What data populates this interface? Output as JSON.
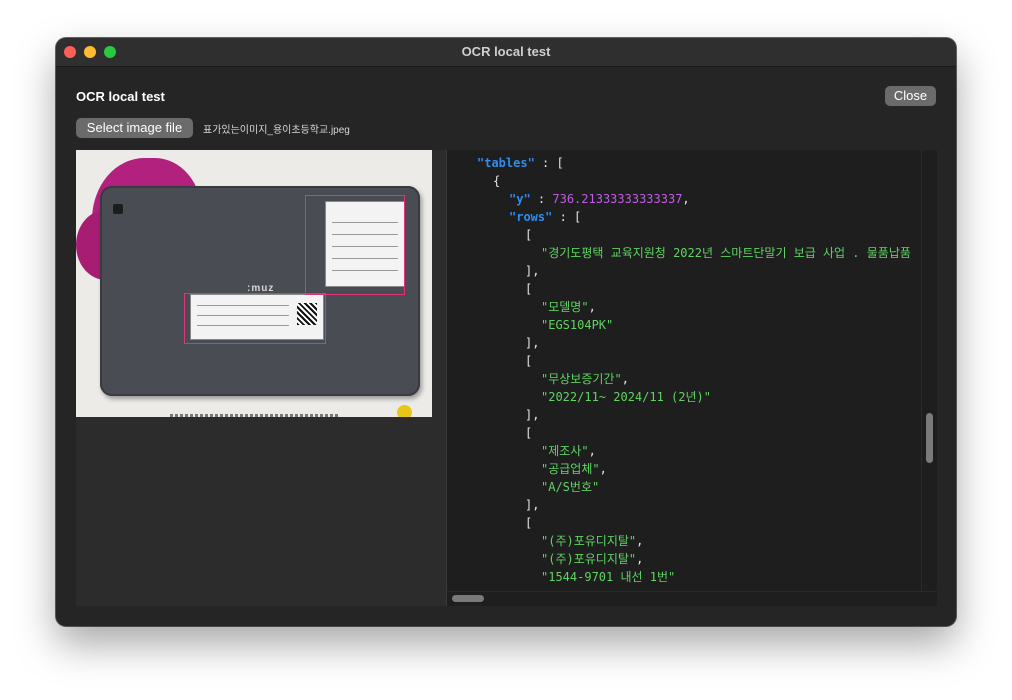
{
  "window": {
    "title": "OCR local test"
  },
  "header": {
    "heading": "OCR local test",
    "close_label": "Close"
  },
  "toolbar": {
    "select_label": "Select image file",
    "file_name": "표가있는이미지_용이초등학교.jpeg"
  },
  "image_preview": {
    "brand_text": ":muz"
  },
  "json_view": {
    "lines": [
      {
        "indent": 0,
        "parts": [
          {
            "t": "k",
            "v": "\"tables\""
          },
          {
            "t": "p",
            "v": " : ["
          }
        ]
      },
      {
        "indent": 1,
        "parts": [
          {
            "t": "p",
            "v": "{"
          }
        ]
      },
      {
        "indent": 2,
        "parts": [
          {
            "t": "k",
            "v": "\"y\""
          },
          {
            "t": "p",
            "v": " : "
          },
          {
            "t": "n",
            "v": "736.21333333333337"
          },
          {
            "t": "p",
            "v": ","
          }
        ]
      },
      {
        "indent": 2,
        "parts": [
          {
            "t": "k",
            "v": "\"rows\""
          },
          {
            "t": "p",
            "v": " : ["
          }
        ]
      },
      {
        "indent": 3,
        "parts": [
          {
            "t": "p",
            "v": "["
          }
        ]
      },
      {
        "indent": 4,
        "parts": [
          {
            "t": "s",
            "v": "\"경기도평택 교육지원청 2022년 스마트단말기 보급 사업 . 물품납품"
          }
        ]
      },
      {
        "indent": 3,
        "parts": [
          {
            "t": "p",
            "v": "],"
          }
        ]
      },
      {
        "indent": 3,
        "parts": [
          {
            "t": "p",
            "v": "["
          }
        ]
      },
      {
        "indent": 4,
        "parts": [
          {
            "t": "s",
            "v": "\"모델명\""
          },
          {
            "t": "p",
            "v": ","
          }
        ]
      },
      {
        "indent": 4,
        "parts": [
          {
            "t": "s",
            "v": "\"EGS104PK\""
          }
        ]
      },
      {
        "indent": 3,
        "parts": [
          {
            "t": "p",
            "v": "],"
          }
        ]
      },
      {
        "indent": 3,
        "parts": [
          {
            "t": "p",
            "v": "["
          }
        ]
      },
      {
        "indent": 4,
        "parts": [
          {
            "t": "s",
            "v": "\"무상보증기간\""
          },
          {
            "t": "p",
            "v": ","
          }
        ]
      },
      {
        "indent": 4,
        "parts": [
          {
            "t": "s",
            "v": "\"2022/11~ 2024/11 (2년)\""
          }
        ]
      },
      {
        "indent": 3,
        "parts": [
          {
            "t": "p",
            "v": "],"
          }
        ]
      },
      {
        "indent": 3,
        "parts": [
          {
            "t": "p",
            "v": "["
          }
        ]
      },
      {
        "indent": 4,
        "parts": [
          {
            "t": "s",
            "v": "\"제조사\""
          },
          {
            "t": "p",
            "v": ","
          }
        ]
      },
      {
        "indent": 4,
        "parts": [
          {
            "t": "s",
            "v": "\"공급업체\""
          },
          {
            "t": "p",
            "v": ","
          }
        ]
      },
      {
        "indent": 4,
        "parts": [
          {
            "t": "s",
            "v": "\"A/S번호\""
          }
        ]
      },
      {
        "indent": 3,
        "parts": [
          {
            "t": "p",
            "v": "],"
          }
        ]
      },
      {
        "indent": 3,
        "parts": [
          {
            "t": "p",
            "v": "["
          }
        ]
      },
      {
        "indent": 4,
        "parts": [
          {
            "t": "s",
            "v": "\"(주)포유디지탈\""
          },
          {
            "t": "p",
            "v": ","
          }
        ]
      },
      {
        "indent": 4,
        "parts": [
          {
            "t": "s",
            "v": "\"(주)포유디지탈\""
          },
          {
            "t": "p",
            "v": ","
          }
        ]
      },
      {
        "indent": 4,
        "parts": [
          {
            "t": "s",
            "v": "\"1544-9701 내선 1번\""
          }
        ]
      }
    ]
  },
  "colors": {
    "key": "#2f8cf0",
    "number": "#c05ce5",
    "string": "#5fd463",
    "punct": "#e6e6e6"
  }
}
